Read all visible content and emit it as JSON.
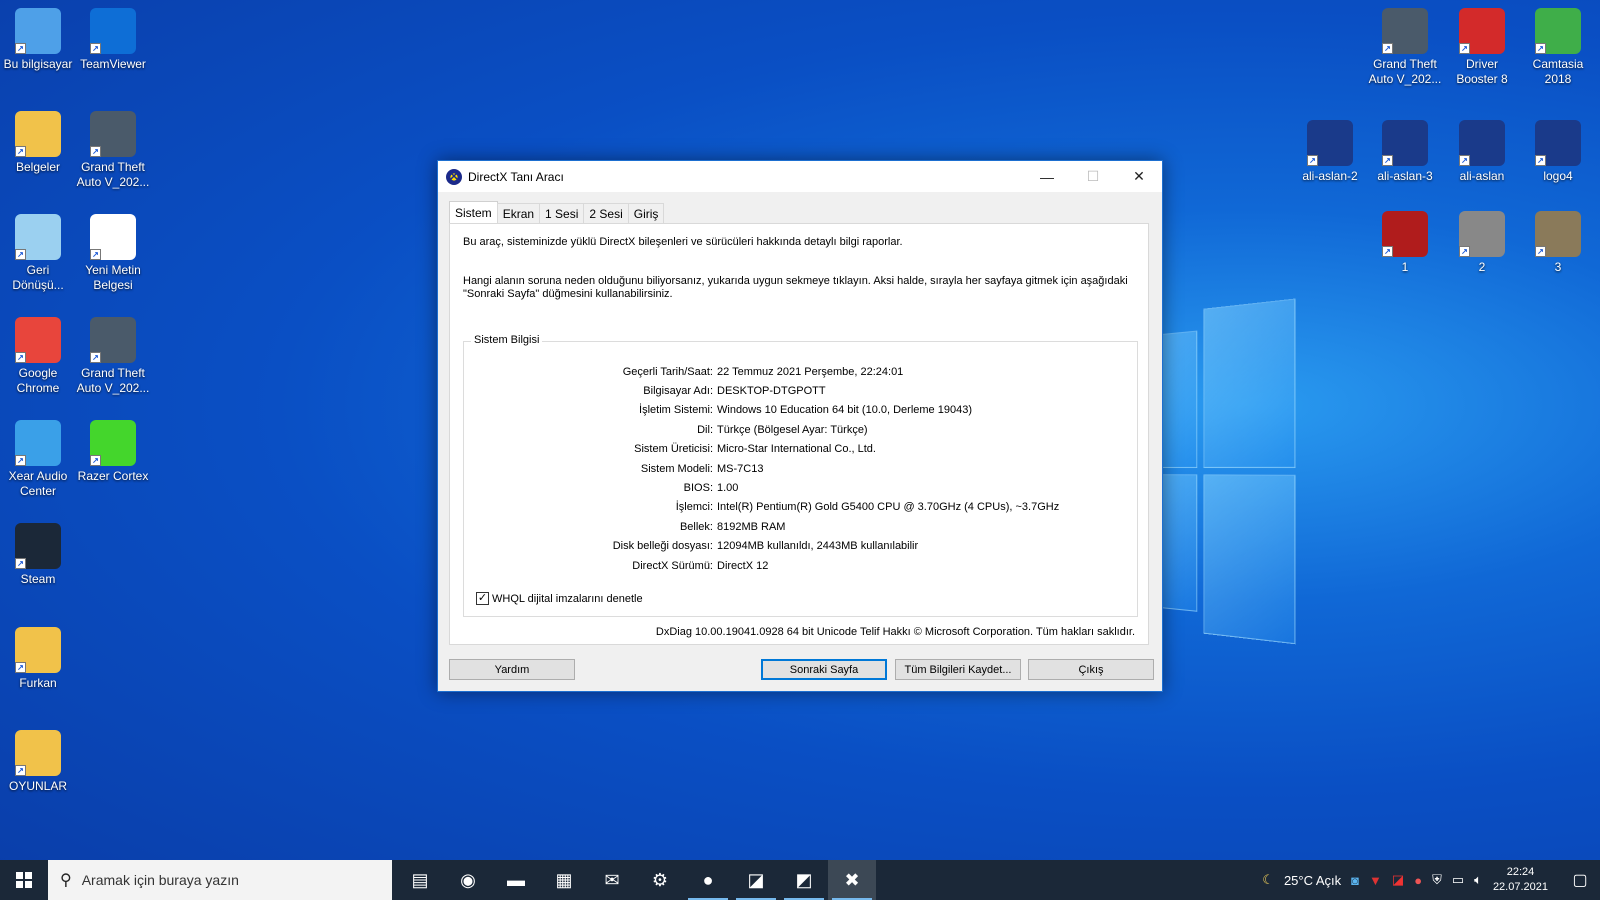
{
  "desktop": {
    "left_icons": [
      {
        "label": "Bu bilgisayar",
        "icon": "computer-icon",
        "color": "#4ea0e8"
      },
      {
        "label": "TeamViewer",
        "icon": "teamviewer-icon",
        "color": "#0e6ed6"
      },
      {
        "label": "Belgeler",
        "icon": "documents-folder-icon",
        "color": "#f1c24a"
      },
      {
        "label": "Grand Theft Auto V_202...",
        "icon": "gta-video-icon",
        "color": "#4a5a6a"
      },
      {
        "label": "Geri Dönüşü...",
        "icon": "recycle-bin-icon",
        "color": "#9bd0f0"
      },
      {
        "label": "Yeni Metin Belgesi",
        "icon": "text-document-icon",
        "color": "#ffffff"
      },
      {
        "label": "Google Chrome",
        "icon": "chrome-icon",
        "color": "#e8453c"
      },
      {
        "label": "Grand Theft Auto V_202...",
        "icon": "gta-video-icon",
        "color": "#4a5a6a"
      },
      {
        "label": "Xear Audio Center",
        "icon": "xear-audio-icon",
        "color": "#3aa0e8"
      },
      {
        "label": "Razer Cortex",
        "icon": "razer-cortex-icon",
        "color": "#44d62c"
      },
      {
        "label": "Steam",
        "icon": "steam-icon",
        "color": "#1b2838"
      },
      {
        "label": "Furkan",
        "icon": "folder-icon",
        "color": "#f1c24a"
      },
      {
        "label": "OYUNLAR",
        "icon": "games-folder-icon",
        "color": "#f1c24a"
      }
    ],
    "right_icons": [
      {
        "label": "Grand Theft Auto V_202...",
        "icon": "gta-video-icon",
        "color": "#4a5a6a"
      },
      {
        "label": "Driver Booster 8",
        "icon": "driver-booster-icon",
        "color": "#d32a2a"
      },
      {
        "label": "Camtasia 2018",
        "icon": "camtasia-icon",
        "color": "#3fae49"
      },
      {
        "label": "ali-aslan-2",
        "icon": "image-icon",
        "color": "#1a3a8a"
      },
      {
        "label": "ali-aslan-3",
        "icon": "image-icon",
        "color": "#1a3a8a"
      },
      {
        "label": "ali-aslan",
        "icon": "image-icon",
        "color": "#1a3a8a"
      },
      {
        "label": "logo4",
        "icon": "image-icon",
        "color": "#1a3a8a"
      },
      {
        "label": "1",
        "icon": "image-icon",
        "color": "#b01c1c"
      },
      {
        "label": "2",
        "icon": "image-icon",
        "color": "#888888"
      },
      {
        "label": "3",
        "icon": "image-icon",
        "color": "#8a7a5a"
      }
    ]
  },
  "window": {
    "title": "DirectX Tanı Aracı",
    "tabs": [
      "Sistem",
      "Ekran",
      "1 Sesi",
      "2 Sesi",
      "Giriş"
    ],
    "intro": "Bu araç, sisteminizde yüklü DirectX bileşenleri ve sürücüleri hakkında detaylı bilgi raporlar.",
    "instructions": "Hangi alanın soruna neden olduğunu biliyorsanız, yukarıda uygun sekmeye tıklayın. Aksi halde, sırayla her sayfaya gitmek için aşağıdaki \"Sonraki Sayfa\" düğmesini kullanabilirsiniz.",
    "group_title": "Sistem Bilgisi",
    "info": [
      {
        "k": "Geçerli Tarih/Saat:",
        "v": "22 Temmuz 2021 Perşembe, 22:24:01"
      },
      {
        "k": "Bilgisayar Adı:",
        "v": "DESKTOP-DTGPOTT"
      },
      {
        "k": "İşletim Sistemi:",
        "v": "Windows 10 Education 64 bit (10.0, Derleme 19043)"
      },
      {
        "k": "Dil:",
        "v": "Türkçe (Bölgesel Ayar: Türkçe)"
      },
      {
        "k": "Sistem Üreticisi:",
        "v": "Micro-Star International Co., Ltd."
      },
      {
        "k": "Sistem Modeli:",
        "v": "MS-7C13"
      },
      {
        "k": "BIOS:",
        "v": "1.00"
      },
      {
        "k": "İşlemci:",
        "v": "Intel(R) Pentium(R) Gold G5400 CPU @ 3.70GHz (4 CPUs), ~3.7GHz"
      },
      {
        "k": "Bellek:",
        "v": "8192MB RAM"
      },
      {
        "k": "Disk belleği dosyası:",
        "v": "12094MB kullanıldı, 2443MB kullanılabilir"
      },
      {
        "k": "DirectX Sürümü:",
        "v": "DirectX 12"
      }
    ],
    "checkbox_label": "WHQL dijital imzalarını denetle",
    "checkbox_checked": true,
    "footer": "DxDiag 10.00.19041.0928 64 bit Unicode  Telif Hakkı © Microsoft Corporation. Tüm hakları saklıdır.",
    "buttons": {
      "help": "Yardım",
      "next": "Sonraki Sayfa",
      "save": "Tüm Bilgileri Kaydet...",
      "exit": "Çıkış"
    }
  },
  "taskbar": {
    "search_placeholder": "Aramak için buraya yazın",
    "apps": [
      {
        "icon": "task-view-icon",
        "glyph": "▤"
      },
      {
        "icon": "edge-icon",
        "glyph": "◉"
      },
      {
        "icon": "file-explorer-icon",
        "glyph": "▬"
      },
      {
        "icon": "store-icon",
        "glyph": "▦"
      },
      {
        "icon": "mail-icon",
        "glyph": "✉"
      },
      {
        "icon": "driver-booster-icon",
        "glyph": "⚙"
      },
      {
        "icon": "chrome-icon",
        "glyph": "●"
      },
      {
        "icon": "amd-icon",
        "glyph": "◪"
      },
      {
        "icon": "app-red-icon",
        "glyph": "◩"
      },
      {
        "icon": "directx-icon",
        "glyph": "✖"
      }
    ],
    "weather": "25°C  Açık",
    "time": "22:24",
    "date": "22.07.2021"
  }
}
